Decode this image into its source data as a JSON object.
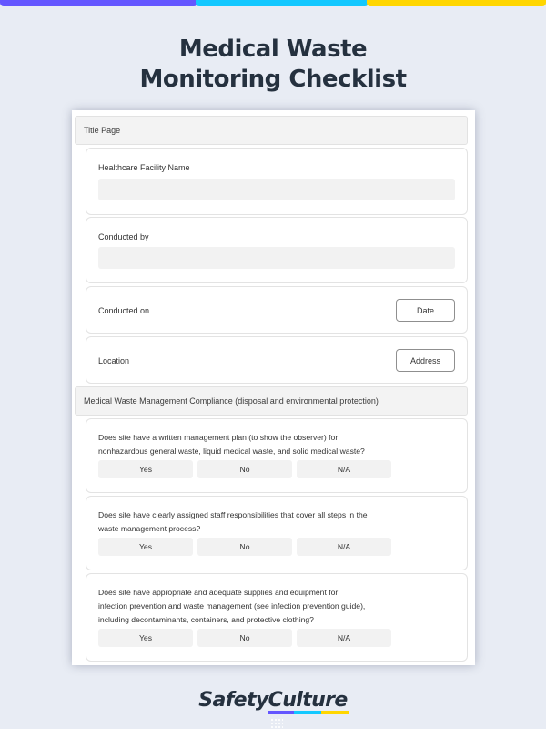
{
  "brand_colors": {
    "purple": "#6456ff",
    "cyan": "#13c8ff",
    "yellow": "#ffd600",
    "dark": "#25313f"
  },
  "header": {
    "title_line1": "Medical Waste",
    "title_line2": "Monitoring Checklist"
  },
  "sections": [
    {
      "title": "Title Page",
      "fields": [
        {
          "label": "Healthcare Facility Name",
          "type": "text",
          "value": ""
        },
        {
          "label": "Conducted by",
          "type": "text",
          "value": ""
        },
        {
          "label": "Conducted on",
          "type": "button",
          "button_label": "Date"
        },
        {
          "label": "Location",
          "type": "button",
          "button_label": "Address"
        }
      ]
    },
    {
      "title": "Medical Waste Management Compliance (disposal and environmental protection)",
      "questions": [
        {
          "lines": [
            "Does site have a written management plan (to show the observer) for",
            "nonhazardous general waste, liquid medical waste, and solid medical waste?"
          ],
          "options": [
            "Yes",
            "No",
            "N/A"
          ]
        },
        {
          "lines": [
            "Does site have clearly assigned staff responsibilities that cover all steps in the",
            "waste management process?"
          ],
          "options": [
            "Yes",
            "No",
            "N/A"
          ]
        },
        {
          "lines": [
            "Does site have appropriate and adequate supplies and equipment for",
            "infection prevention and waste management (see infection prevention guide),",
            "including decontaminants, containers, and protective clothing?"
          ],
          "options": [
            "Yes",
            "No",
            "N/A"
          ]
        }
      ]
    }
  ],
  "footer": {
    "logo_text": "SafetyCulture"
  }
}
